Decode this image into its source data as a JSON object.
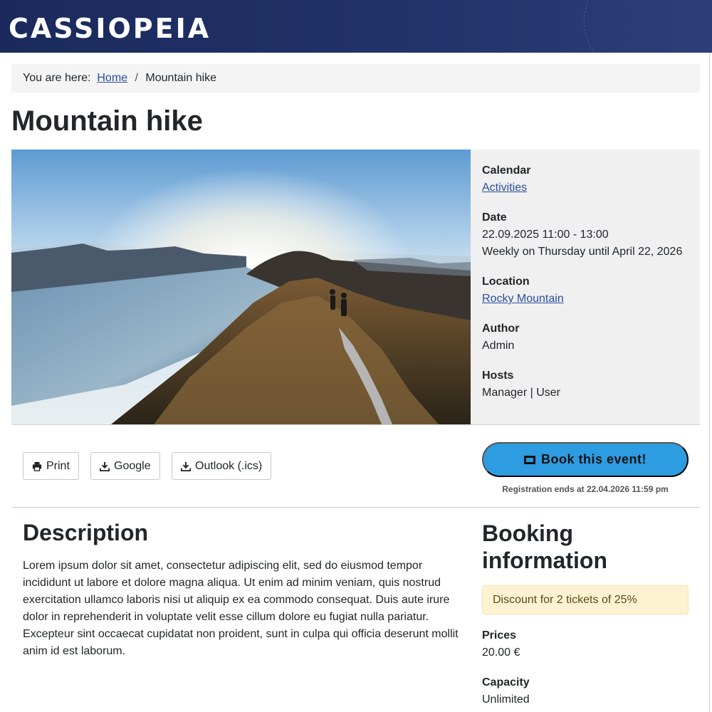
{
  "site": {
    "brand": "CASSIOPEIA"
  },
  "breadcrumb": {
    "prefix": "You are here:",
    "home": "Home",
    "separator": "/",
    "current": "Mountain hike"
  },
  "page": {
    "title": "Mountain hike"
  },
  "event_info": {
    "calendar_label": "Calendar",
    "calendar_value": "Activities",
    "date_label": "Date",
    "date_value": "22.09.2025 11:00 - 13:00",
    "recurrence": "Weekly on Thursday until April 22, 2026",
    "location_label": "Location",
    "location_value": "Rocky Mountain",
    "author_label": "Author",
    "author_value": "Admin",
    "hosts_label": "Hosts",
    "hosts_value": "Manager | User"
  },
  "actions": {
    "print": "Print",
    "google": "Google",
    "outlook": "Outlook (.ics)",
    "book": "Book this event!",
    "registration_note": "Registration ends at 22.04.2026 11:59 pm"
  },
  "description": {
    "title": "Description",
    "text": "Lorem ipsum dolor sit amet, consectetur adipiscing elit, sed do eiusmod tempor incididunt ut labore et dolore magna aliqua. Ut enim ad minim veniam, quis nostrud exercitation ullamco laboris nisi ut aliquip ex ea commodo consequat. Duis aute irure dolor in reprehenderit in voluptate velit esse cillum dolore eu fugiat nulla pariatur. Excepteur sint occaecat cupidatat non proident, sunt in culpa qui officia deserunt mollit anim id est laborum."
  },
  "booking": {
    "title": "Booking information",
    "discount": "Discount for 2 tickets of 25%",
    "prices_label": "Prices",
    "prices_value": "20.00 €",
    "capacity_label": "Capacity",
    "capacity_value": "Unlimited"
  },
  "colors": {
    "header": "#1b2a5c",
    "accent": "#2e9ce0",
    "link": "#2a4ea1",
    "discount_bg": "#fdf3d3"
  },
  "icons": {
    "print": "printer-icon",
    "google": "download-icon",
    "outlook": "download-icon",
    "book": "ticket-icon"
  }
}
